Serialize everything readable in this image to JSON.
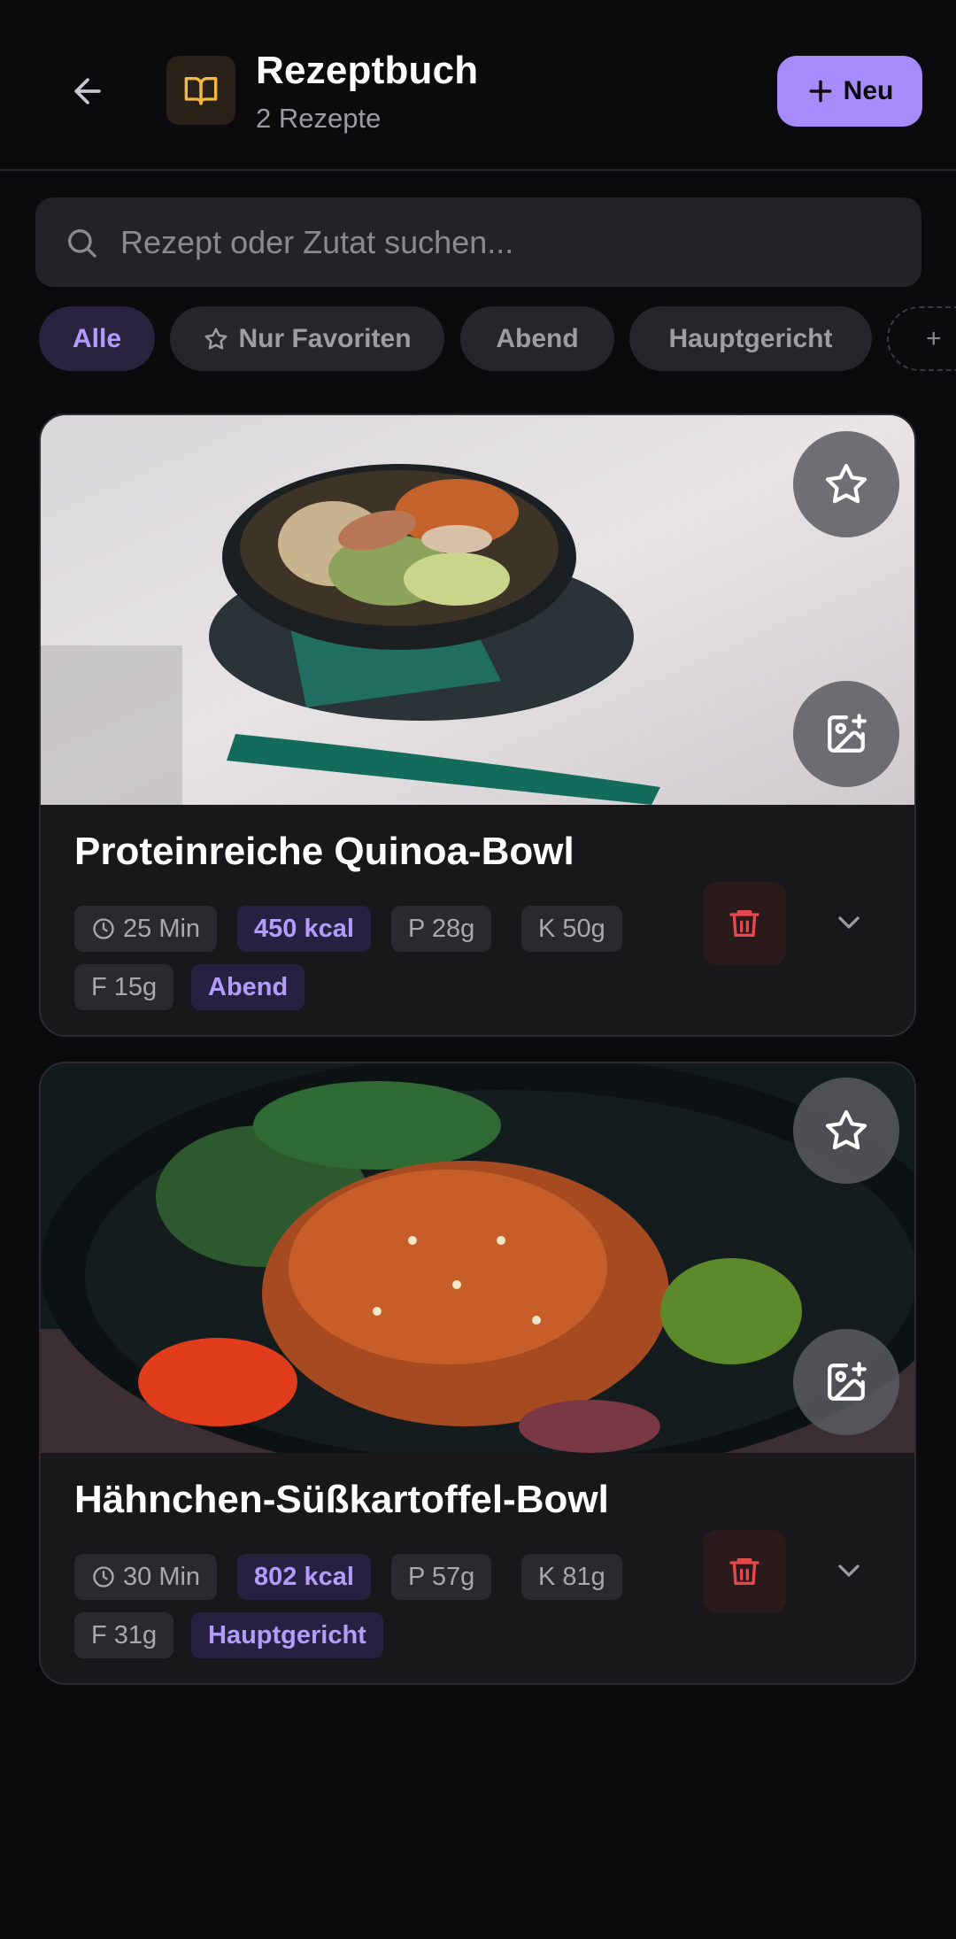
{
  "header": {
    "title": "Rezeptbuch",
    "subtitle": "2 Rezepte",
    "new_button_label": "Neu",
    "icons": {
      "back": "arrow-left-icon",
      "book": "book-open-icon",
      "plus": "plus-icon"
    }
  },
  "search": {
    "placeholder": "Rezept oder Zutat suchen...",
    "value": ""
  },
  "filters": {
    "chips": [
      {
        "label": "Alle",
        "active": true
      },
      {
        "label": "Nur Favoriten",
        "active": false,
        "icon": "star-icon"
      },
      {
        "label": "Abend",
        "active": false
      },
      {
        "label": "Hauptgericht",
        "active": false
      },
      {
        "label": "+",
        "active": false
      }
    ]
  },
  "recipes": [
    {
      "title": "Proteinreiche Quinoa-Bowl",
      "time": "25 Min",
      "kcal": "450 kcal",
      "protein": "P 28g",
      "carbs": "K 50g",
      "fat": "F 15g",
      "category": "Abend",
      "favorite": false
    },
    {
      "title": "Hähnchen-Süßkartoffel-Bowl",
      "time": "30 Min",
      "kcal": "802 kcal",
      "protein": "P 57g",
      "carbs": "K 81g",
      "fat": "F 31g",
      "category": "Hauptgericht",
      "favorite": false
    }
  ],
  "colors": {
    "background": "#0b0b0e",
    "accent": "#a78bfa",
    "card": "#18181b",
    "delete": "#e5484d",
    "book_icon": "#f5b942"
  }
}
